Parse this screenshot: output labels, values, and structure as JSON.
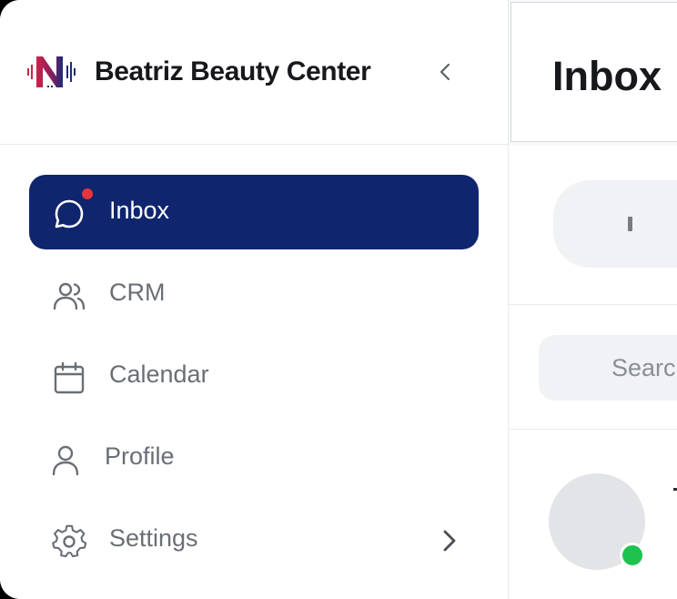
{
  "sidebar": {
    "brand_name": "Beatriz Beauty Center",
    "logo_icon": "n-soundwave-logo",
    "items": [
      {
        "label": "Inbox",
        "icon": "chat-bubble-icon",
        "active": true,
        "has_notification": true
      },
      {
        "label": "CRM",
        "icon": "users-icon",
        "active": false
      },
      {
        "label": "Calendar",
        "icon": "calendar-icon",
        "active": false
      },
      {
        "label": "Profile",
        "icon": "user-icon",
        "active": false
      },
      {
        "label": "Settings",
        "icon": "gear-icon",
        "active": false,
        "has_submenu": true
      }
    ]
  },
  "main": {
    "title": "Inbox",
    "search": {
      "placeholder": "Search"
    }
  },
  "colors": {
    "active_nav_bg": "#0f256e",
    "notification_dot": "#e8343c",
    "online_status": "#1ec34f",
    "logo_red": "#c8203e",
    "logo_navy": "#1e2a78"
  }
}
